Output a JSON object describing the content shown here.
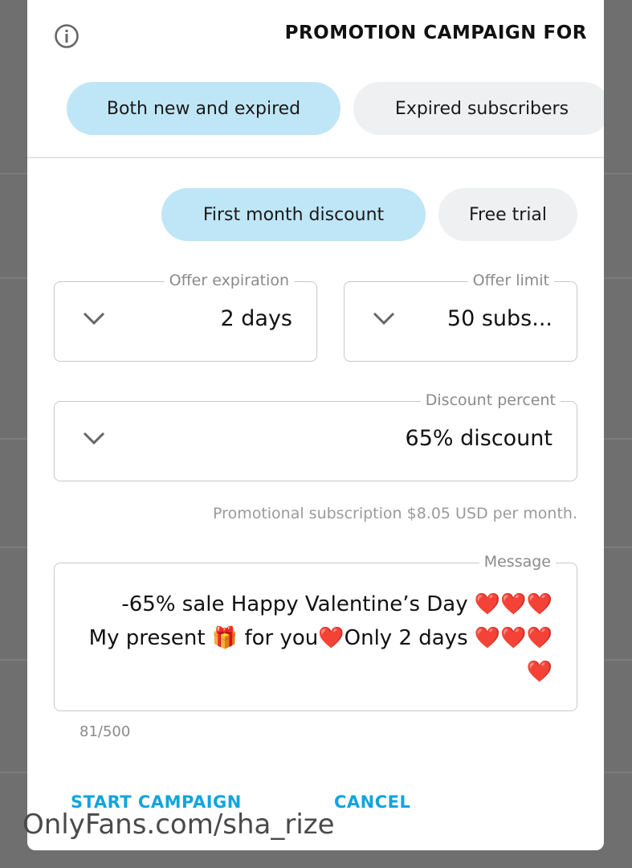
{
  "dialog": {
    "title": "PROMOTION CAMPAIGN FOR",
    "icon": "info-icon"
  },
  "audience": {
    "options": [
      {
        "label": "Expired subscribers",
        "selected": false
      },
      {
        "label": "Both new and expired",
        "selected": true
      }
    ]
  },
  "promo_type": {
    "options": [
      {
        "label": "Free trial",
        "selected": false
      },
      {
        "label": "First month discount",
        "selected": true
      }
    ]
  },
  "offer_limit": {
    "legend": "Offer limit",
    "value": "50 subs..."
  },
  "offer_expiration": {
    "legend": "Offer expiration",
    "value": "2 days"
  },
  "discount_percent": {
    "legend": "Discount percent",
    "value": "65% discount"
  },
  "helper_text": "Promotional subscription $8.05 USD per month.",
  "message": {
    "legend": "Message",
    "text": "-65% sale Happy Valentine’s Day ❤️❤️❤️ My present 🎁 for you❤️Only 2 days ❤️❤️❤️❤️",
    "counter": "81/500"
  },
  "actions": {
    "cancel": "CANCEL",
    "start": "START CAMPAIGN"
  },
  "watermark": "OnlyFans.com/sha_rize",
  "colors": {
    "accent": "#10a4df",
    "selected_pill": "#bfe6f6",
    "unselected_pill": "#eef0f1"
  }
}
